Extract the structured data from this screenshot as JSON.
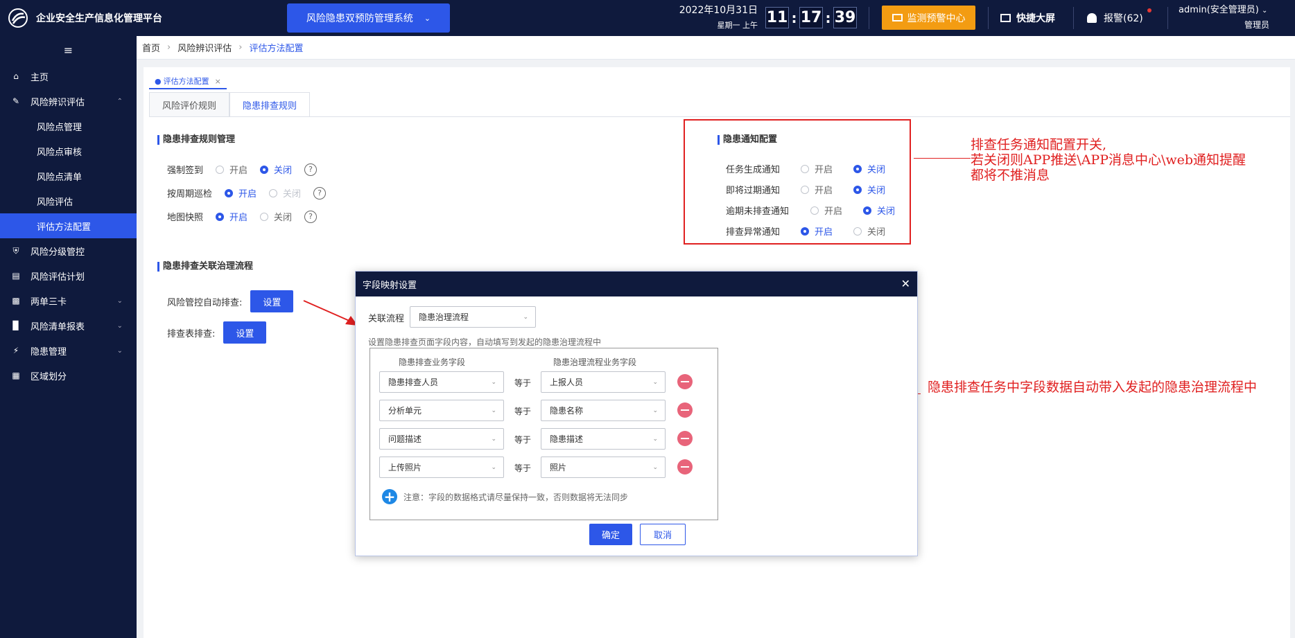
{
  "topbar": {
    "title": "企业安全生产信息化管理平台",
    "system_select": "风险隐患双预防管理系统",
    "date": "2022年10月31日",
    "weekday": "星期一  上午",
    "clock_h": "11",
    "clock_m": "17",
    "clock_s": "39",
    "monitor_btn": "监测预警中心",
    "bigscreen": "快捷大屏",
    "alarm": "报警(62)",
    "user_name": "admin(安全管理员)",
    "user_role": "管理员"
  },
  "sidebar": {
    "items": [
      {
        "label": "主页"
      },
      {
        "label": "风险辨识评估"
      },
      {
        "label": "风险点管理"
      },
      {
        "label": "风险点审核"
      },
      {
        "label": "风险点清单"
      },
      {
        "label": "风险评估"
      },
      {
        "label": "评估方法配置"
      },
      {
        "label": "风险分级管控"
      },
      {
        "label": "风险评估计划"
      },
      {
        "label": "两单三卡"
      },
      {
        "label": "风险清单报表"
      },
      {
        "label": "隐患管理"
      },
      {
        "label": "区域划分"
      }
    ]
  },
  "breadcrumb": [
    "首页",
    "风险辨识评估",
    "评估方法配置"
  ],
  "page_tab": "评估方法配置",
  "subtabs": [
    "风险评价规则",
    "隐患排查规则"
  ],
  "radio": {
    "on": "开启",
    "off": "关闭"
  },
  "rules": {
    "title": "隐患排查规则管理",
    "rows": [
      {
        "label": "强制签到",
        "selected": "关闭"
      },
      {
        "label": "按周期巡检",
        "selected": "开启"
      },
      {
        "label": "地图快照",
        "selected": "开启"
      }
    ]
  },
  "notify": {
    "title": "隐患通知配置",
    "rows": [
      {
        "label": "任务生成通知",
        "selected": "关闭"
      },
      {
        "label": "即将过期通知",
        "selected": "关闭"
      },
      {
        "label": "逾期未排查通知",
        "selected": "关闭"
      },
      {
        "label": "排查异常通知",
        "selected": "开启"
      }
    ]
  },
  "flow": {
    "title": "隐患排查关联治理流程",
    "row1_label": "风险管控自动排查:",
    "row2_label": "排查表排查:",
    "set_btn": "设置"
  },
  "annotations": {
    "a1_line1": "排查任务通知配置开关,",
    "a1_line2": "若关闭则APP推送\\APP消息中心\\web通知提醒",
    "a1_line3": "都将不推消息",
    "a2": "隐患排查任务中字段数据自动带入发起的隐患治理流程中"
  },
  "dialog": {
    "title": "字段映射设置",
    "flow_label": "关联流程",
    "flow_value": "隐患治理流程",
    "hint": "设置隐患排查页面字段内容，自动填写到发起的隐患治理流程中",
    "col_left": "隐患排查业务字段",
    "col_right": "隐患治理流程业务字段",
    "equals": "等于",
    "mappings": [
      {
        "left": "隐患排查人员",
        "right": "上报人员"
      },
      {
        "left": "分析单元",
        "right": "隐患名称"
      },
      {
        "left": "问题描述",
        "right": "隐患描述"
      },
      {
        "left": "上传照片",
        "right": "照片"
      }
    ],
    "note": "注意：字段的数据格式请尽量保持一致，否则数据将无法同步",
    "ok": "确定",
    "cancel": "取消"
  },
  "colors": {
    "accent": "#2d57e8",
    "nav_bg": "#0f1a3d",
    "warn": "#f39c12",
    "annotation": "#e02020"
  }
}
